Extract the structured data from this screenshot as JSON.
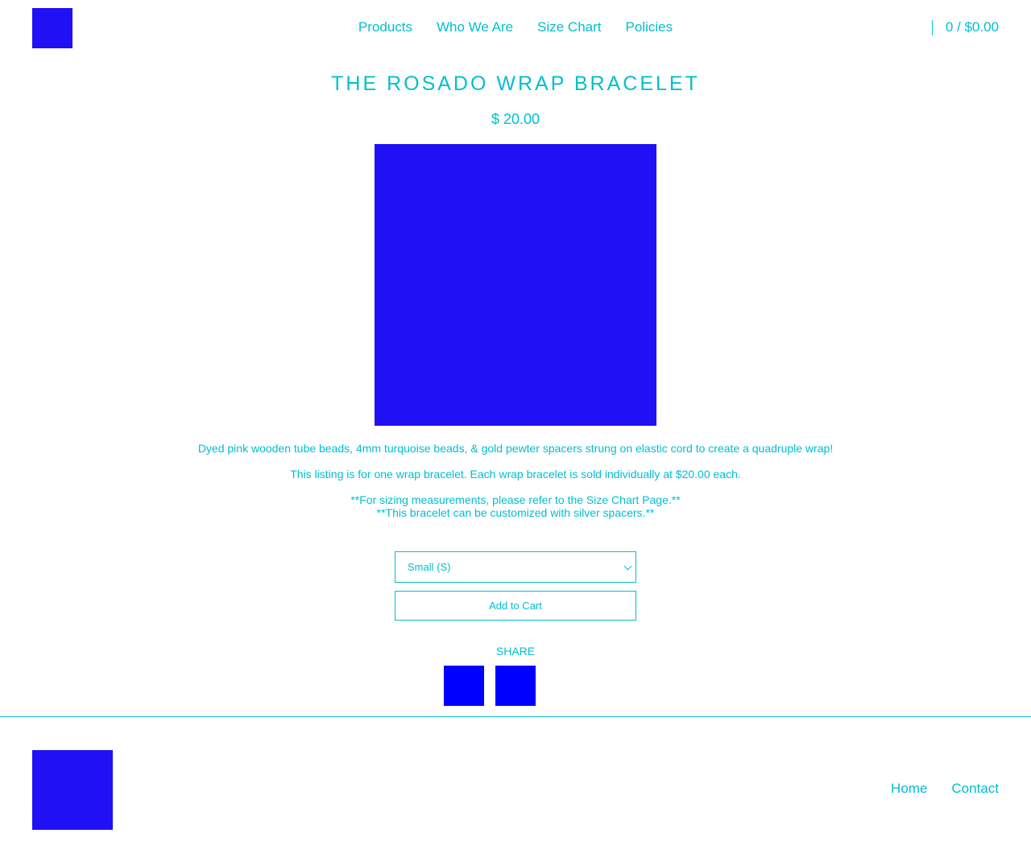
{
  "header": {
    "logo": "store-logo",
    "nav": [
      "Products",
      "Who We Are",
      "Size Chart",
      "Policies"
    ],
    "cart": "0 / $0.00"
  },
  "product": {
    "title": "THE ROSADO WRAP BRACELET",
    "price": "$ 20.00",
    "description": [
      "Dyed pink wooden tube beads, 4mm turquoise beads, & gold pewter spacers strung on elastic cord to create a quadruple wrap!",
      "This listing is for one wrap bracelet. Each wrap bracelet is sold individually at $20.00 each.",
      "**For sizing measurements, please refer to the Size Chart Page.**",
      "**This bracelet can be customized with silver spacers.**"
    ],
    "size_selected": "Small (S)",
    "add_to_cart": "Add to Cart"
  },
  "share": {
    "label": "SHARE"
  },
  "footer": {
    "nav": [
      "Home",
      "Contact"
    ]
  },
  "colors": {
    "accent": "#00bfcf",
    "placeholder_block": "#2010f5",
    "share_block": "#0000ff",
    "background": "#ffffff"
  }
}
